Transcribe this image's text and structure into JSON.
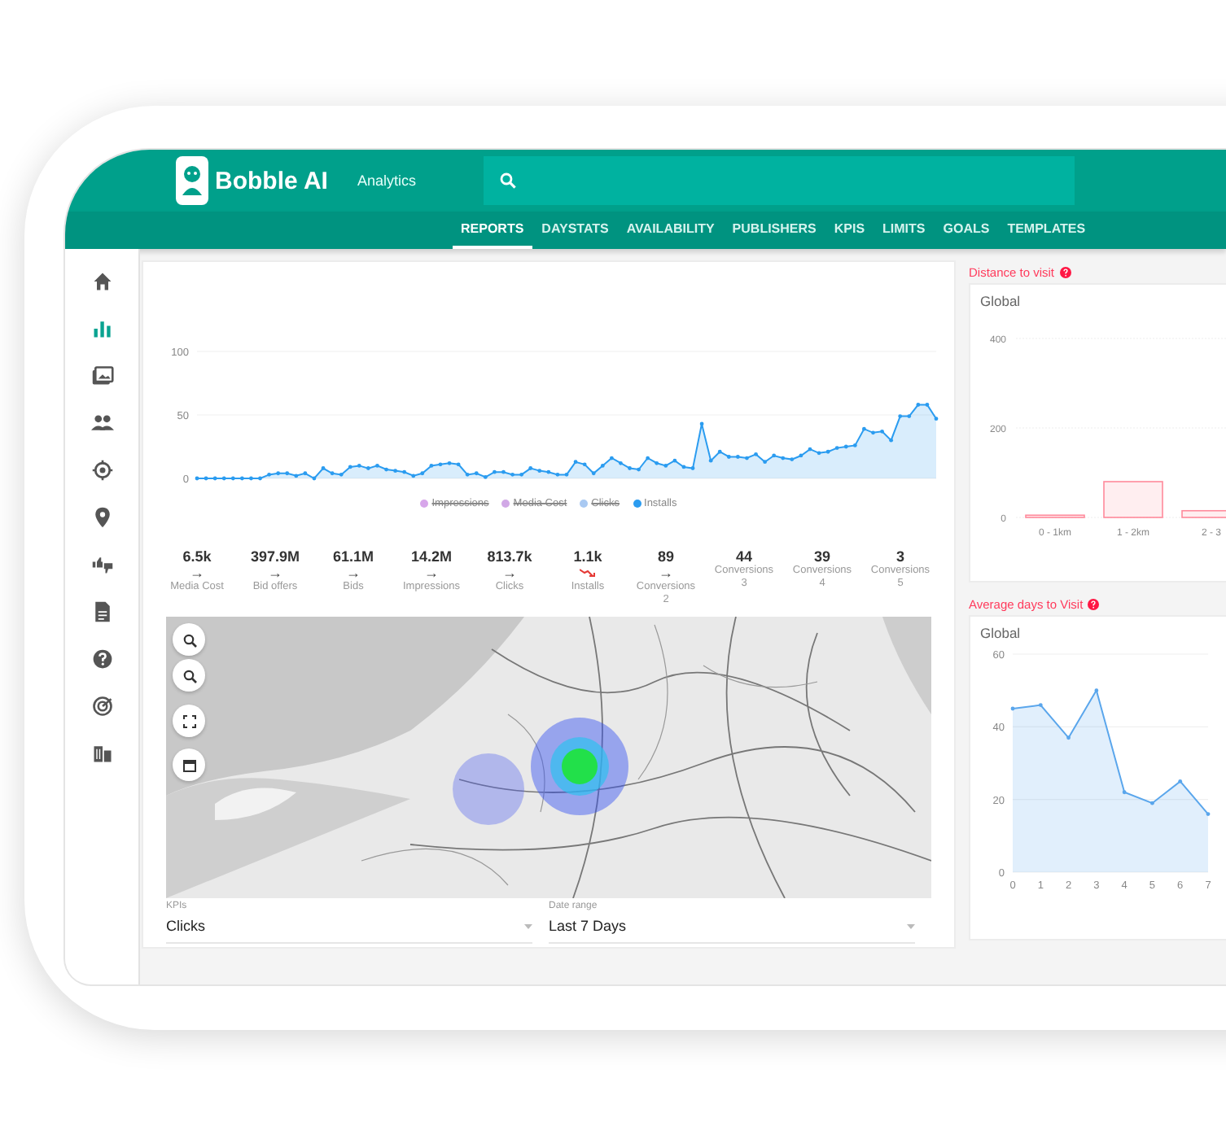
{
  "header": {
    "brand": "Bobble AI",
    "product": "Analytics"
  },
  "nav": [
    {
      "label": "REPORTS",
      "selected": true
    },
    {
      "label": "DAYSTATS",
      "selected": false
    },
    {
      "label": "AVAILABILITY",
      "selected": false
    },
    {
      "label": "PUBLISHERS",
      "selected": false
    },
    {
      "label": "KPIS",
      "selected": false
    },
    {
      "label": "LIMITS",
      "selected": false
    },
    {
      "label": "GOALS",
      "selected": false
    },
    {
      "label": "TEMPLATES",
      "selected": false
    }
  ],
  "sidebar": {
    "items": [
      {
        "selected": false
      },
      {
        "selected": true
      },
      {
        "selected": false
      },
      {
        "selected": false
      },
      {
        "selected": false
      },
      {
        "selected": false
      },
      {
        "selected": false
      },
      {
        "selected": false
      },
      {
        "selected": false
      },
      {
        "selected": false
      },
      {
        "selected": false
      }
    ]
  },
  "trend_chart": {
    "chart_data": {
      "type": "area",
      "yticks": [
        0,
        50,
        100
      ],
      "ylim": [
        0,
        100
      ],
      "series": [
        {
          "name": "Installs",
          "color": "#2b9cf0",
          "values": [
            0,
            0,
            0,
            0,
            0,
            0,
            0,
            0,
            3,
            4,
            4,
            2,
            4,
            0,
            8,
            4,
            3,
            9,
            10,
            8,
            10,
            7,
            6,
            5,
            2,
            4,
            10,
            11,
            12,
            11,
            3,
            4,
            1,
            5,
            5,
            3,
            3,
            8,
            6,
            5,
            3,
            3,
            13,
            11,
            4,
            10,
            16,
            12,
            8,
            7,
            16,
            12,
            10,
            14,
            9,
            8,
            43,
            14,
            21,
            17,
            17,
            16,
            19,
            13,
            18,
            16,
            15,
            18,
            23,
            20,
            21,
            24,
            25,
            26,
            39,
            36,
            37,
            30,
            49,
            49,
            58,
            58,
            47
          ]
        }
      ]
    },
    "legend": [
      {
        "label": "Impressions",
        "color": "#d7a6ea",
        "hidden": true
      },
      {
        "label": "Media Cost",
        "color": "#d1a8e6",
        "hidden": true
      },
      {
        "label": "Clicks",
        "color": "#a9c9f2",
        "hidden": true
      }
    ]
  },
  "stats": [
    {
      "value": "6.5k",
      "arrow": "→",
      "declining": false,
      "label": "Media Cost"
    },
    {
      "value": "397.9M",
      "arrow": "→",
      "declining": false,
      "label": "Bid offers"
    },
    {
      "value": "61.1M",
      "arrow": "→",
      "declining": false,
      "label": "Bids"
    },
    {
      "value": "14.2M",
      "arrow": "→",
      "declining": false,
      "label": "Impressions"
    },
    {
      "value": "813.7k",
      "arrow": "→",
      "declining": false,
      "label": "Clicks"
    },
    {
      "value": "1.1k",
      "declining": true,
      "label": "Installs"
    },
    {
      "value": "89",
      "arrow": "→",
      "declining": false,
      "label": "Conversions 2"
    },
    {
      "value": "44",
      "declining": false,
      "label": "Conversions 3"
    },
    {
      "value": "39",
      "declining": false,
      "label": "Conversions 4"
    },
    {
      "value": "3",
      "declining": false,
      "label": "Conversions 5"
    }
  ],
  "filters": [
    {
      "label": "KPIs",
      "value": "Clicks"
    },
    {
      "label": "Date range",
      "value": "Last 7 Days"
    }
  ],
  "distance_panel": {
    "title": "Distance to visit",
    "chart_data": {
      "type": "bar",
      "categories": [
        "0 - 1km",
        "1 - 2km",
        "2 - 3"
      ],
      "yticks": [
        0,
        200,
        400
      ],
      "ylim": [
        0,
        400
      ],
      "series": [
        {
          "name": "Global",
          "color": "#ff8a9c",
          "values": [
            5,
            80,
            15
          ]
        }
      ]
    }
  },
  "days_panel": {
    "title": "Average days to Visit",
    "chart_data": {
      "type": "area",
      "categories": [
        "0",
        "1",
        "2",
        "3",
        "4",
        "5",
        "6",
        "7"
      ],
      "yticks": [
        0,
        20,
        40,
        60
      ],
      "ylim": [
        0,
        60
      ],
      "series": [
        {
          "name": "Global",
          "color": "#5aa6ec",
          "values": [
            45,
            46,
            37,
            50,
            22,
            19,
            25,
            16
          ]
        }
      ]
    }
  }
}
